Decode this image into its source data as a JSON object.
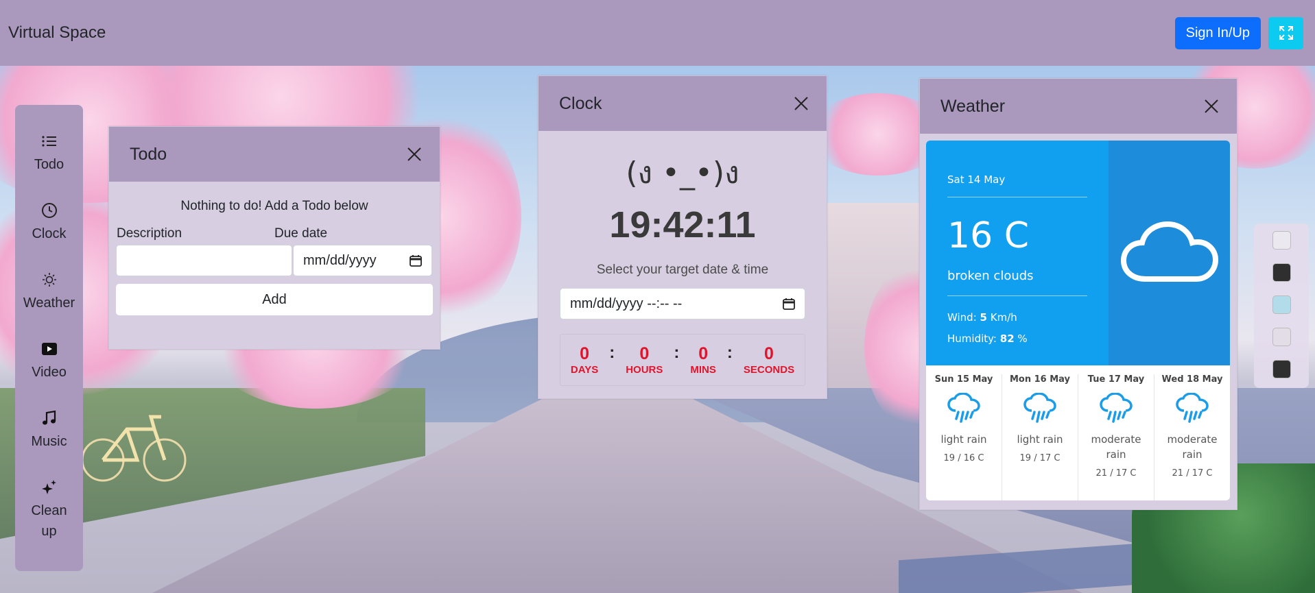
{
  "navbar": {
    "brand": "Virtual Space",
    "signin_label": "Sign In/Up",
    "fullscreen_icon": "fullscreen-icon"
  },
  "sidebar": {
    "items": [
      {
        "label": "Todo",
        "icon": "list-icon"
      },
      {
        "label": "Clock",
        "icon": "clock-icon"
      },
      {
        "label": "Weather",
        "icon": "sun-icon"
      },
      {
        "label": "Video",
        "icon": "play-icon"
      },
      {
        "label": "Music",
        "icon": "music-note-icon"
      },
      {
        "label": "Clean up",
        "icon": "sparkles-icon"
      }
    ]
  },
  "todo": {
    "title": "Todo",
    "empty_message": "Nothing to do! Add a Todo below",
    "description_label": "Description",
    "description_value": "",
    "due_label": "Due date",
    "due_placeholder": "mm/dd/yyyy",
    "add_label": "Add"
  },
  "clock": {
    "title": "Clock",
    "kaomoji": "(ง •_•)ง",
    "time": "19:42:11",
    "target_label": "Select your target date & time",
    "datetime_placeholder": "mm/dd/yyyy --:-- --",
    "countdown": [
      {
        "value": "0",
        "unit": "DAYS"
      },
      {
        "value": "0",
        "unit": "HOURS"
      },
      {
        "value": "0",
        "unit": "MINS"
      },
      {
        "value": "0",
        "unit": "SECONDS"
      }
    ],
    "separator": ":"
  },
  "weather": {
    "title": "Weather",
    "date": "Sat 14 May",
    "temperature": "16 C",
    "description": "broken clouds",
    "wind_label": "Wind:",
    "wind_value": "5",
    "wind_unit": "Km/h",
    "humidity_label": "Humidity:",
    "humidity_value": "82",
    "humidity_unit": "%",
    "main_icon": "cloud-icon",
    "forecast": [
      {
        "day": "Sun 15 May",
        "condition": "light rain",
        "temps": "19 / 16 C",
        "icon": "rain-cloud-icon"
      },
      {
        "day": "Mon 16 May",
        "condition": "light rain",
        "temps": "19 / 17 C",
        "icon": "rain-cloud-icon"
      },
      {
        "day": "Tue 17 May",
        "condition": "moderate rain",
        "temps": "21 / 17 C",
        "icon": "rain-cloud-icon"
      },
      {
        "day": "Wed 18 May",
        "condition": "moderate rain",
        "temps": "21 / 17 C",
        "icon": "rain-cloud-icon"
      }
    ]
  },
  "theme_swatches": [
    "#ece8ef",
    "#2f2f2f",
    "#b2dcea",
    "#e3dde8",
    "#2f2f2f"
  ],
  "colors": {
    "navbar": "#ab98bd",
    "primary": "#0d6efd",
    "info": "#0dcaf0",
    "countdown": "#e0142b",
    "weather_blue": "#119ff0"
  }
}
